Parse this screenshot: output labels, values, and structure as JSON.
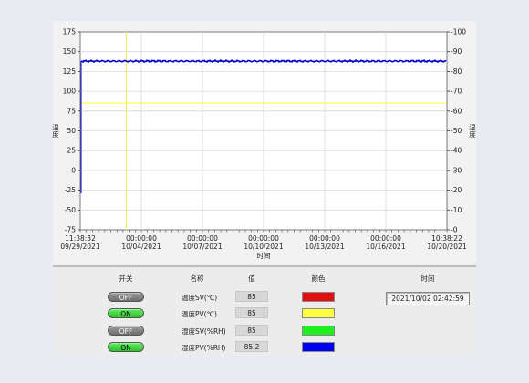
{
  "chart_data": {
    "type": "line",
    "xlabel": "时间",
    "ylabel_left": "温度",
    "ylabel_right": "湿度",
    "y_left_ticks": [
      175,
      150,
      125,
      100,
      75,
      50,
      25,
      0,
      -25,
      -50,
      -75
    ],
    "y_right_ticks": [
      100,
      90,
      80,
      70,
      60,
      50,
      40,
      30,
      20,
      10,
      0
    ],
    "ylim_left": [
      -75,
      175
    ],
    "ylim_right": [
      0,
      100
    ],
    "x_ticks": [
      {
        "time": "11:38:32",
        "date": "09/29/2021"
      },
      {
        "time": "00:00:00",
        "date": "10/04/2021"
      },
      {
        "time": "00:00:00",
        "date": "10/07/2021"
      },
      {
        "time": "00:00:00",
        "date": "10/10/2021"
      },
      {
        "time": "00:00:00",
        "date": "10/13/2021"
      },
      {
        "time": "00:00:00",
        "date": "10/16/2021"
      },
      {
        "time": "10:38:22",
        "date": "10/20/2021"
      }
    ],
    "series": [
      {
        "name": "温度PV(℃)",
        "axis": "left",
        "color": "#ffff40",
        "level": 85
      },
      {
        "name": "湿度PV(%RH)",
        "axis": "right",
        "color": "#0000cc",
        "level": 85.2
      }
    ],
    "cursor_date": "10/02/2021",
    "grid": true
  },
  "table": {
    "headers": {
      "switch": "开关",
      "name": "名称",
      "value": "值",
      "color": "颜色",
      "time": "时间"
    },
    "rows": [
      {
        "state": "OFF",
        "on": false,
        "name": "温度SV(℃)",
        "value": "85",
        "color": "#e01010"
      },
      {
        "state": "ON",
        "on": true,
        "name": "温度PV(℃)",
        "value": "85",
        "color": "#ffff40"
      },
      {
        "state": "OFF",
        "on": false,
        "name": "湿度SV(%RH)",
        "value": "85",
        "color": "#20ee20"
      },
      {
        "state": "ON",
        "on": true,
        "name": "湿度PV(%RH)",
        "value": "85.2",
        "color": "#0000ee"
      }
    ],
    "time_value": "2021/10/02 02:42:59"
  }
}
